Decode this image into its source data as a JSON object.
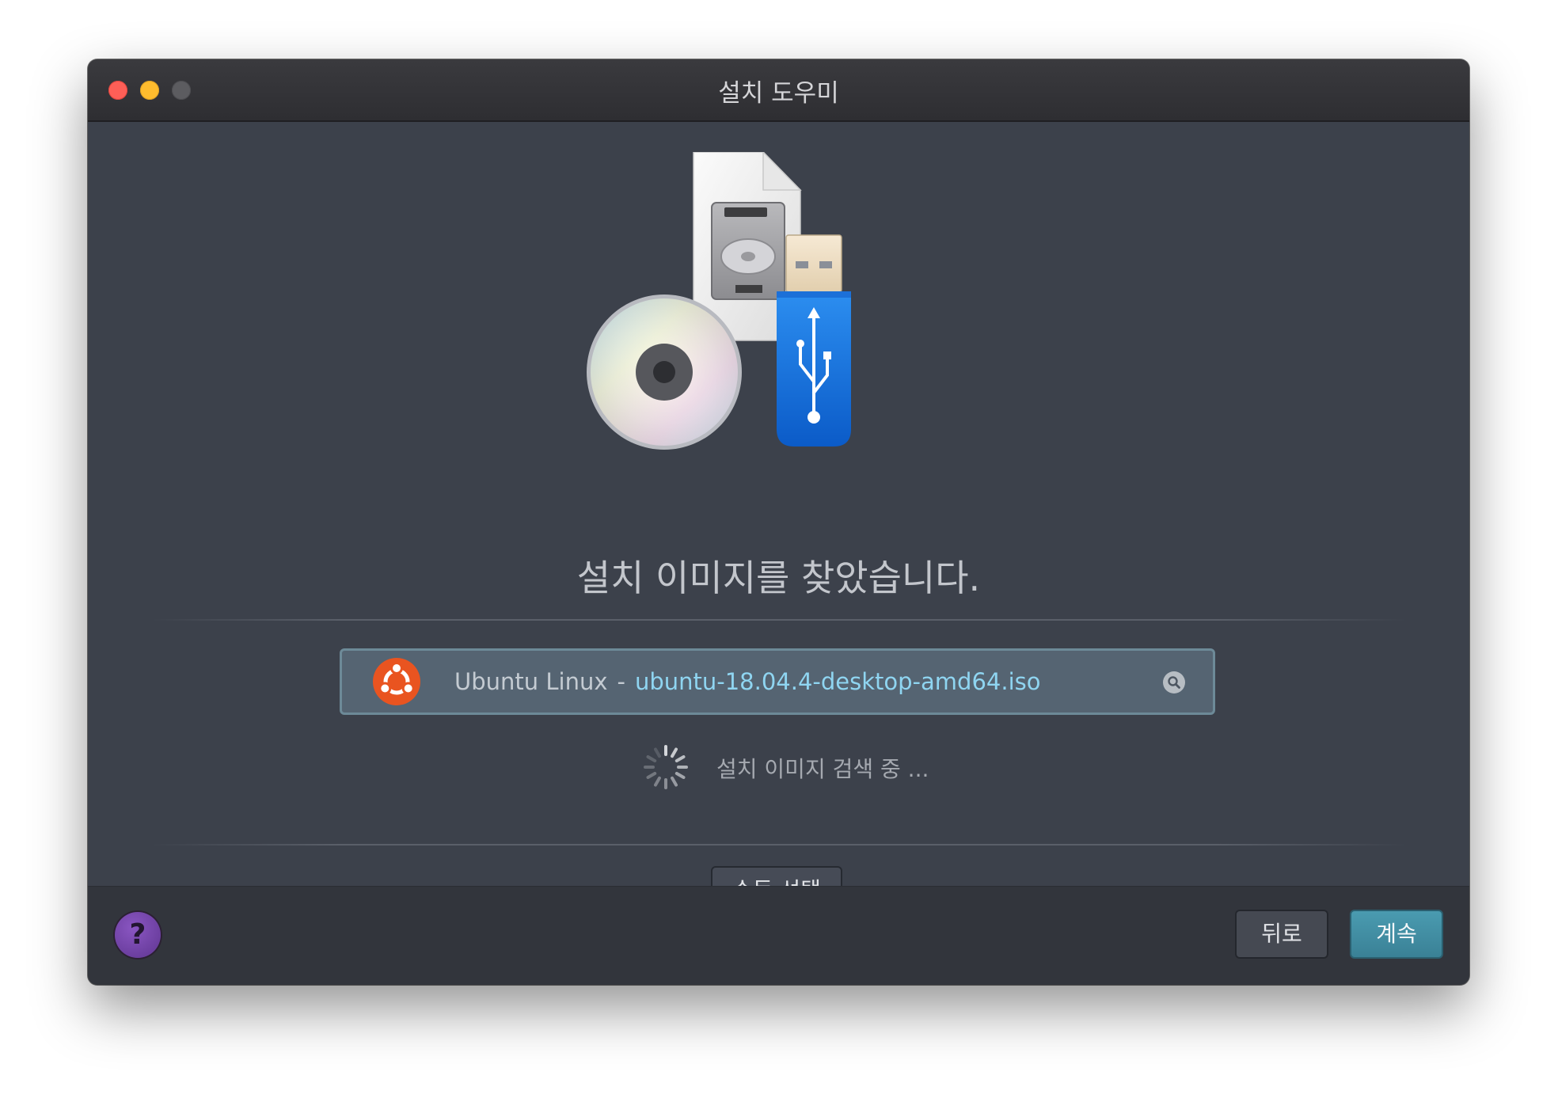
{
  "window": {
    "title": "설치 도우미"
  },
  "main": {
    "heading": "설치 이미지를 찾았습니다.",
    "detected_image": {
      "os_name": "Ubuntu Linux",
      "separator": "-",
      "file_name": "ubuntu-18.04.4-desktop-amd64.iso",
      "icon": "ubuntu-logo-icon"
    },
    "status_text": "설치 이미지 검색 중 ...",
    "manual_select_label": "수동 선택"
  },
  "footer": {
    "help_label": "?",
    "back_label": "뒤로",
    "continue_label": "계속"
  },
  "colors": {
    "window_bg": "#3c414b",
    "accent": "#3a8196",
    "file_link": "#8fd5f1",
    "ubuntu_orange": "#e95420",
    "help_purple": "#6f3fa3"
  }
}
